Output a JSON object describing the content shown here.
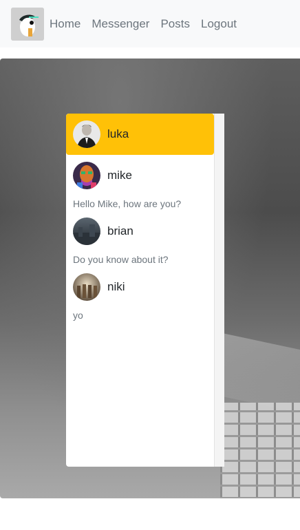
{
  "nav": {
    "links": [
      "Home",
      "Messenger",
      "Posts",
      "Logout"
    ]
  },
  "chats": [
    {
      "name": "luka",
      "preview": "",
      "active": true
    },
    {
      "name": "mike",
      "preview": "Hello Mike, how are you?",
      "active": false
    },
    {
      "name": "brian",
      "preview": "Do you know about it?",
      "active": false
    },
    {
      "name": "niki",
      "preview": "yo",
      "active": false
    }
  ],
  "colors": {
    "active_chat": "#ffc107",
    "navbar_bg": "#f8f9fa",
    "nav_link": "#6c757d"
  },
  "icons": {
    "brand": "app-logo-icon"
  }
}
